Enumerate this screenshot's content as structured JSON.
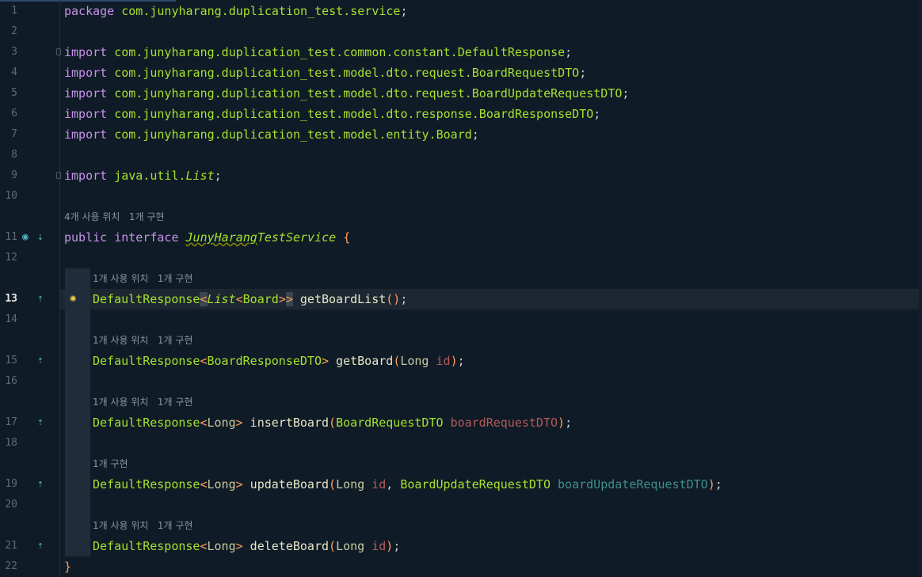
{
  "editor": {
    "lines": [
      {
        "num": "1",
        "parts": [
          {
            "t": "package",
            "c": "kw"
          },
          {
            "t": " com.junyharang.duplication_test.service",
            "c": "pk"
          },
          {
            "t": ";",
            "c": "pn"
          }
        ]
      },
      {
        "num": "2",
        "parts": []
      },
      {
        "num": "3",
        "parts": [
          {
            "t": "import",
            "c": "kw"
          },
          {
            "t": " com.junyharang.duplication_test.common.constant.DefaultResponse",
            "c": "pk"
          },
          {
            "t": ";",
            "c": "pn"
          }
        ]
      },
      {
        "num": "4",
        "parts": [
          {
            "t": "import",
            "c": "kw"
          },
          {
            "t": " com.junyharang.duplication_test.model.dto.request.BoardRequestDTO",
            "c": "pk"
          },
          {
            "t": ";",
            "c": "pn"
          }
        ]
      },
      {
        "num": "5",
        "parts": [
          {
            "t": "import",
            "c": "kw"
          },
          {
            "t": " com.junyharang.duplication_test.model.dto.request.BoardUpdateRequestDTO",
            "c": "pk"
          },
          {
            "t": ";",
            "c": "pn"
          }
        ]
      },
      {
        "num": "6",
        "parts": [
          {
            "t": "import",
            "c": "kw"
          },
          {
            "t": " com.junyharang.duplication_test.model.dto.response.BoardResponseDTO",
            "c": "pk"
          },
          {
            "t": ";",
            "c": "pn"
          }
        ]
      },
      {
        "num": "7",
        "parts": [
          {
            "t": "import",
            "c": "kw"
          },
          {
            "t": " com.junyharang.duplication_test.model.entity.Board",
            "c": "pk"
          },
          {
            "t": ";",
            "c": "pn"
          }
        ]
      },
      {
        "num": "8",
        "parts": []
      },
      {
        "num": "9",
        "parts": [
          {
            "t": "import",
            "c": "kw"
          },
          {
            "t": " java.util.",
            "c": "pk"
          },
          {
            "t": "List",
            "c": "it"
          },
          {
            "t": ";",
            "c": "pn"
          }
        ]
      },
      {
        "num": "10",
        "parts": []
      },
      {
        "num": "11",
        "parts": [
          {
            "t": "public interface ",
            "c": "kw"
          },
          {
            "t": "JunyHarang",
            "c": "it squig"
          },
          {
            "t": "TestService",
            "c": "it"
          },
          {
            "t": " {",
            "c": "brace"
          }
        ]
      },
      {
        "num": "12",
        "parts": []
      },
      {
        "num": "13",
        "parts": [
          {
            "t": "DefaultResponse",
            "c": "ty"
          },
          {
            "t": "<",
            "c": "gen cursor-box"
          },
          {
            "t": "List",
            "c": "it"
          },
          {
            "t": "<",
            "c": "gen"
          },
          {
            "t": "Board",
            "c": "ty"
          },
          {
            "t": ">",
            "c": "gen"
          },
          {
            "t": ">",
            "c": "gen cursor-box"
          },
          {
            "t": " getBoardList",
            "c": "fn"
          },
          {
            "t": "()",
            "c": "par"
          },
          {
            "t": ";",
            "c": "pn"
          }
        ]
      },
      {
        "num": "14",
        "parts": []
      },
      {
        "num": "15",
        "parts": [
          {
            "t": "DefaultResponse",
            "c": "ty"
          },
          {
            "t": "<",
            "c": "gen"
          },
          {
            "t": "BoardResponseDTO",
            "c": "ty"
          },
          {
            "t": ">",
            "c": "gen"
          },
          {
            "t": " getBoard",
            "c": "fn"
          },
          {
            "t": "(",
            "c": "par"
          },
          {
            "t": "Long ",
            "c": "lt"
          },
          {
            "t": "id",
            "c": "prm"
          },
          {
            "t": ")",
            "c": "par"
          },
          {
            "t": ";",
            "c": "pn"
          }
        ]
      },
      {
        "num": "16",
        "parts": []
      },
      {
        "num": "17",
        "parts": [
          {
            "t": "DefaultResponse",
            "c": "ty"
          },
          {
            "t": "<",
            "c": "gen"
          },
          {
            "t": "Long",
            "c": "lt"
          },
          {
            "t": ">",
            "c": "gen"
          },
          {
            "t": " insertBoard",
            "c": "fn"
          },
          {
            "t": "(",
            "c": "par"
          },
          {
            "t": "BoardRequestDTO ",
            "c": "ty"
          },
          {
            "t": "boardRequestDTO",
            "c": "prm"
          },
          {
            "t": ")",
            "c": "par"
          },
          {
            "t": ";",
            "c": "pn"
          }
        ]
      },
      {
        "num": "18",
        "parts": []
      },
      {
        "num": "19",
        "parts": [
          {
            "t": "DefaultResponse",
            "c": "ty"
          },
          {
            "t": "<",
            "c": "gen"
          },
          {
            "t": "Long",
            "c": "lt"
          },
          {
            "t": ">",
            "c": "gen"
          },
          {
            "t": " updateBoard",
            "c": "fn"
          },
          {
            "t": "(",
            "c": "par"
          },
          {
            "t": "Long ",
            "c": "lt"
          },
          {
            "t": "id",
            "c": "prm"
          },
          {
            "t": ", ",
            "c": "pn"
          },
          {
            "t": "BoardUpdateRequestDTO ",
            "c": "ty"
          },
          {
            "t": "boardUpdateRequestDTO",
            "c": "prm2"
          },
          {
            "t": ")",
            "c": "par"
          },
          {
            "t": ";",
            "c": "pn"
          }
        ]
      },
      {
        "num": "20",
        "parts": []
      },
      {
        "num": "21",
        "parts": [
          {
            "t": "DefaultResponse",
            "c": "ty"
          },
          {
            "t": "<",
            "c": "gen"
          },
          {
            "t": "Long",
            "c": "lt"
          },
          {
            "t": ">",
            "c": "gen"
          },
          {
            "t": " deleteBoard",
            "c": "fn"
          },
          {
            "t": "(",
            "c": "par"
          },
          {
            "t": "Long ",
            "c": "lt"
          },
          {
            "t": "id",
            "c": "prm"
          },
          {
            "t": ")",
            "c": "par"
          },
          {
            "t": ";",
            "c": "pn"
          }
        ]
      },
      {
        "num": "22",
        "parts": [
          {
            "t": "}",
            "c": "brace"
          }
        ]
      }
    ],
    "hints": {
      "interface": "4개 사용 위치   1개 구현",
      "getBoardList": "1개 사용 위치   1개 구현",
      "getBoard": "1개 사용 위치   1개 구현",
      "insertBoard": "1개 사용 위치   1개 구현",
      "updateBoard": "1개 구현",
      "deleteBoard": "1개 사용 위치   1개 구현"
    },
    "icons": {
      "interface_gutter": "interface-icon",
      "impl_gutter": "implemented-icon",
      "intention": "lightbulb-icon"
    },
    "colors": {
      "background": "#0f1b26",
      "keyword": "#c792ea",
      "type": "#a6e22e",
      "generic": "#ff9d5c",
      "current_line": "#1d2731"
    }
  }
}
